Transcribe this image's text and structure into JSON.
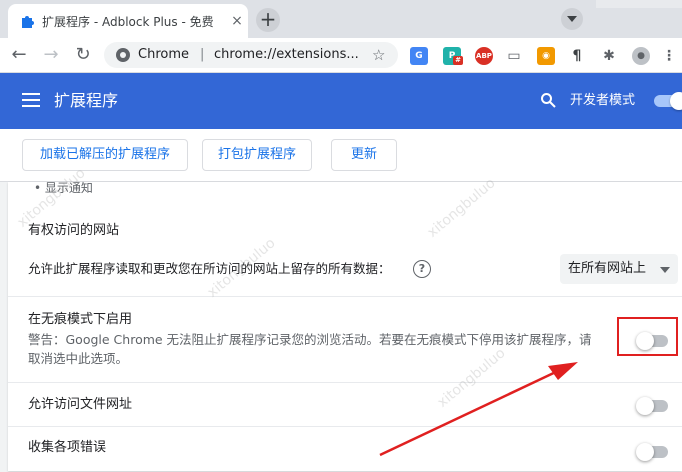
{
  "tab": {
    "title": "扩展程序 - Adblock Plus - 免费",
    "close_icon": "×",
    "new_tab_icon": "+"
  },
  "toolbar": {
    "back_icon": "←",
    "forward_icon": "→",
    "reload_icon": "↻",
    "omnibox_chrome": "Chrome",
    "omnibox_sep": "|",
    "omnibox_url": "chrome://extensions...",
    "star_icon": "☆",
    "extensions": [
      {
        "name": "translate-ext",
        "label": "G",
        "color": "#4285f4"
      },
      {
        "name": "p-ext",
        "label": "P",
        "color": "#20b2aa",
        "badge": "#"
      },
      {
        "name": "abp-ext",
        "label": "ABP",
        "color": "#d93025"
      },
      {
        "name": "tab-ext",
        "label": "▭",
        "color": "#5f6368"
      },
      {
        "name": "tampermonkey-ext",
        "label": "◉",
        "color": "#f29900"
      },
      {
        "name": "paragraph-ext",
        "label": "¶",
        "color": "#3c4043"
      },
      {
        "name": "puzzle-ext",
        "label": "✱",
        "color": "#5f6368"
      },
      {
        "name": "profile-avatar",
        "label": "●",
        "color": "#9aa0a6"
      },
      {
        "name": "menu-dots",
        "label": "⋮",
        "color": "#5f6368"
      }
    ]
  },
  "header": {
    "title": "扩展程序",
    "dev_mode_label": "开发者模式",
    "dev_mode_on": true
  },
  "actions": {
    "load_unpacked": "加载已解压的扩展程序",
    "pack": "打包扩展程序",
    "update": "更新"
  },
  "details": {
    "bullet_text": "显示通知",
    "site_access": {
      "heading": "有权访问的网站",
      "description": "允许此扩展程序读取和更改您在所访问的网站上留存的所有数据：",
      "help_icon": "?",
      "select_value": "在所有网站上"
    },
    "incognito": {
      "label": "在无痕模式下启用",
      "warning_line1": "警告：Google Chrome 无法阻止扩展程序记录您的浏览活动。若要在无痕模式下停用该扩展程序，请",
      "warning_line2": "取消选中此选项。",
      "enabled": false
    },
    "file_urls": {
      "label": "允许访问文件网址",
      "enabled": false
    },
    "collect_errors": {
      "label": "收集各项错误",
      "enabled": false
    }
  },
  "colors": {
    "header_blue": "#3367d6",
    "link_blue": "#1a73e8",
    "annotation_red": "#e02020"
  }
}
